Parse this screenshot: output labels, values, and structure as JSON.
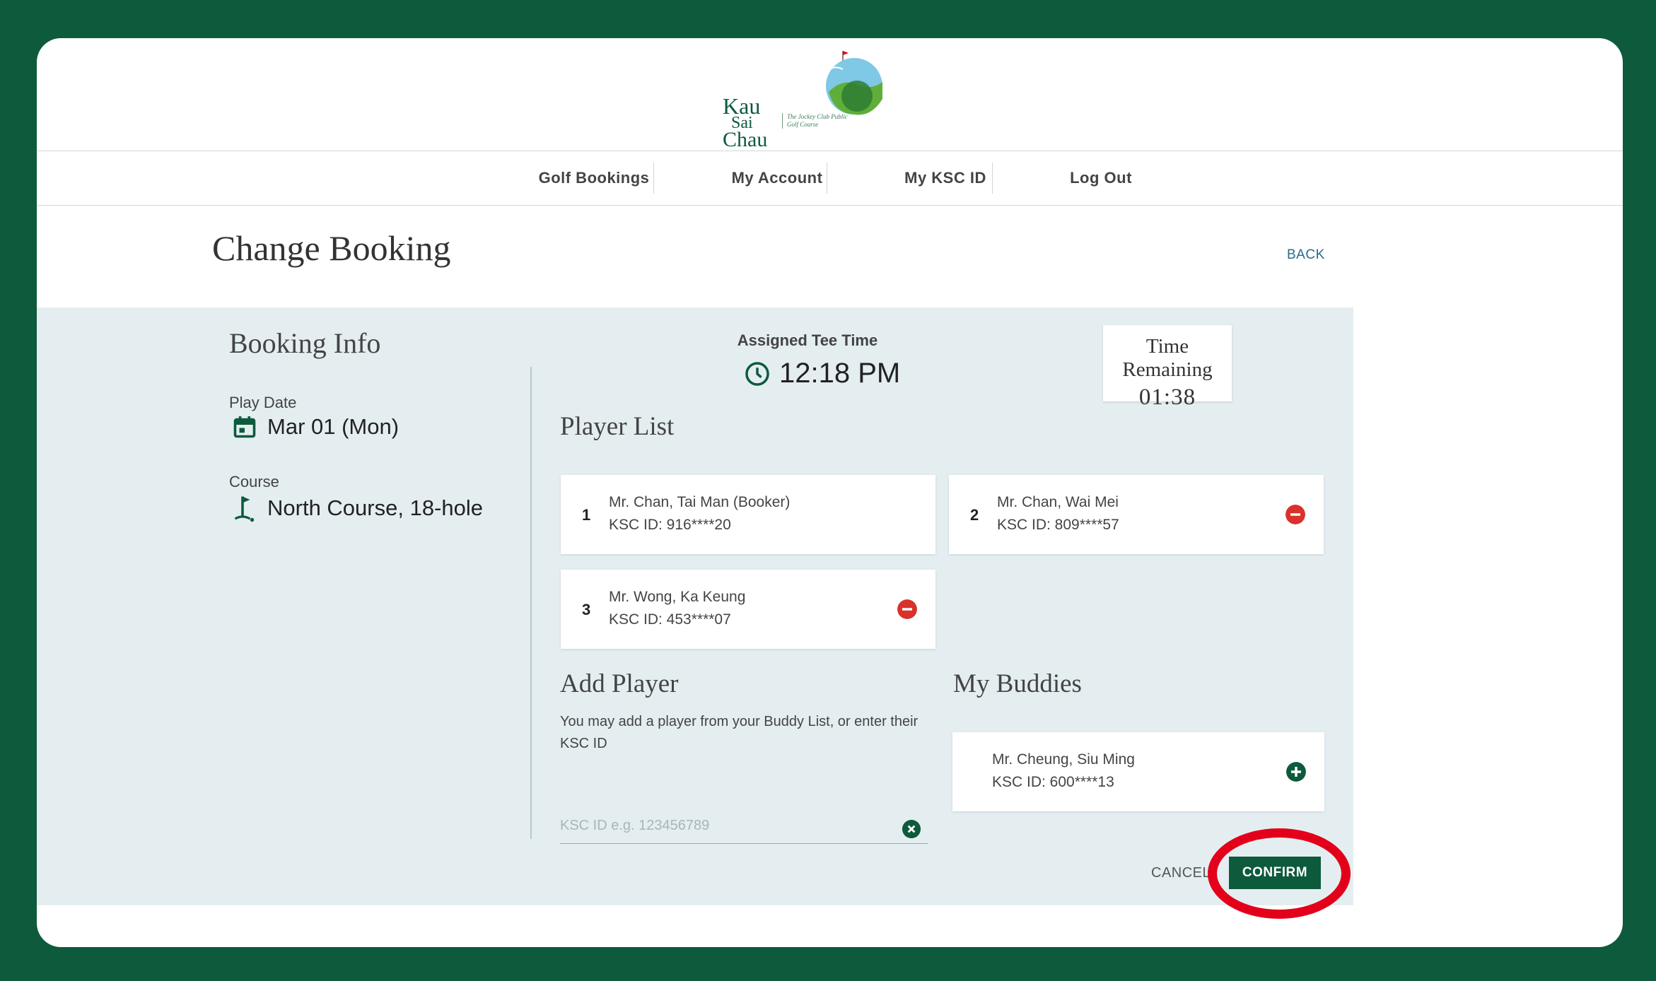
{
  "logo": {
    "name_line1": "Kau",
    "name_line2": "Sai",
    "name_line3": "Chau",
    "subtitle": "The Jockey Club Public Golf Course"
  },
  "nav": {
    "items": [
      {
        "label": "Golf Bookings"
      },
      {
        "label": "My Account"
      },
      {
        "label": "My KSC ID"
      },
      {
        "label": "Log Out"
      }
    ]
  },
  "page": {
    "title": "Change Booking",
    "back_label": "BACK"
  },
  "booking_info": {
    "title": "Booking Info",
    "play_date_label": "Play Date",
    "play_date_value": "Mar 01 (Mon)",
    "course_label": "Course",
    "course_value": "North Course, 18-hole"
  },
  "tee": {
    "label": "Assigned Tee Time",
    "time": "12:18 PM"
  },
  "timer": {
    "label": "Time Remaining",
    "value": "01:38"
  },
  "player_list": {
    "title": "Player List",
    "players": [
      {
        "num": "1",
        "name": "Mr. Chan, Tai Man (Booker)",
        "ksc": "KSC ID: 916****20"
      },
      {
        "num": "2",
        "name": "Mr. Chan, Wai Mei",
        "ksc": "KSC ID: 809****57"
      },
      {
        "num": "3",
        "name": "Mr. Wong, Ka Keung",
        "ksc": "KSC ID: 453****07"
      }
    ]
  },
  "add_player": {
    "title": "Add Player",
    "description": "You may add a player from your Buddy List, or enter their KSC ID",
    "input_placeholder": "KSC ID e.g. 123456789",
    "input_value": ""
  },
  "buddies": {
    "title": "My Buddies",
    "items": [
      {
        "name": "Mr. Cheung, Siu Ming",
        "ksc": "KSC ID: 600****13"
      }
    ]
  },
  "actions": {
    "cancel_label": "CANCEL",
    "confirm_label": "CONFIRM"
  },
  "colors": {
    "brand_green": "#0d5a3c",
    "remove_red": "#d9312b",
    "panel_bg": "#e4eef1",
    "highlight_red": "#e2001a"
  }
}
